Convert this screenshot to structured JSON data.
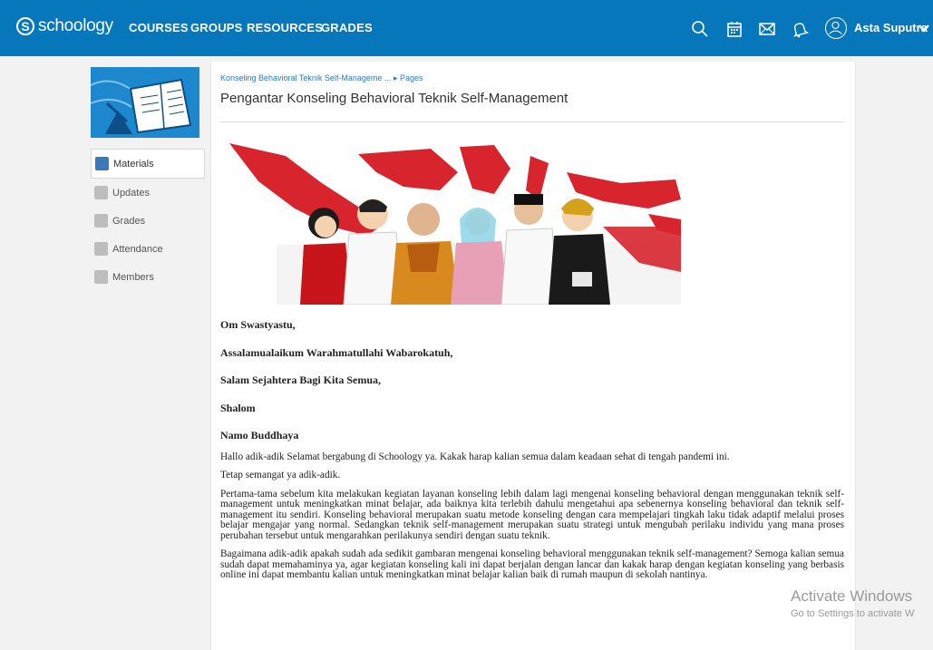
{
  "app": {
    "brand": "schoology",
    "brand_mark": "S",
    "nav": [
      "COURSES",
      "GROUPS",
      "RESOURCES",
      "GRADES"
    ],
    "user_name": "Asta Suputra"
  },
  "sidebar": {
    "items": [
      {
        "label": "Materials",
        "active": true
      },
      {
        "label": "Updates",
        "active": false
      },
      {
        "label": "Grades",
        "active": false
      },
      {
        "label": "Attendance",
        "active": false
      },
      {
        "label": "Members",
        "active": false
      }
    ]
  },
  "page": {
    "breadcrumb_course": "Konseling Behavioral Teknik Self-Manageme ...",
    "breadcrumb_sep": "▸",
    "breadcrumb_section": "Pages",
    "title": "Pengantar Konseling Behavioral Teknik Self-Management"
  },
  "body": {
    "greetings": [
      "Om Swastyastu,",
      "Assalamualaikum Warahmatullahi Wabarokatuh,",
      "Salam Sejahtera Bagi Kita Semua,",
      "Shalom",
      "Namo Buddhaya"
    ],
    "paragraphs": [
      "Hallo adik-adik Selamat bergabung di Schoology ya. Kakak harap kalian semua dalam keadaan sehat di tengah pandemi ini.",
      "Tetap semangat ya adik-adik.",
      "Pertama-tama sebelum kita melakukan kegiatan layanan konseling lebih dalam lagi mengenai konseling behavioral dengan menggunakan teknik self-management untuk meningkatkan minat belajar, ada baiknya kita terlebih dahulu mengetahui apa sebenernya konseling behavioral dan teknik self-management itu sendiri. Konseling behavioral merupakan suatu metode konseling dengan cara mempelajari tingkah laku tidak adaptif melalui proses belajar mengajar yang normal. Sedangkan teknik self-management merupakan suatu strategi untuk mengubah perilaku individu yang mana proses perubahan tersebut untuk mengarahkan perilakunya sendiri dengan suatu teknik.",
      "Bagaimana adik-adik apakah sudah ada sedikit gambaran mengenai konseling behavioral menggunakan teknik self-management? Semoga kalian semua sudah dapat memahaminya ya, agar kegiatan konseling kali ini dapat berjalan dengan lancar dan kakak harap dengan kegiatan konseling yang berbasis online ini dapat membantu kalian untuk meningkatkan minat belajar kalian baik di rumah maupun di sekolah nantinya."
    ]
  },
  "watermark": {
    "line1": "Activate Windows",
    "line2": "Go to Settings to activate W"
  },
  "colors": {
    "header": "#0677ba",
    "link": "#2f79b9",
    "banner_red": "#d8252d"
  }
}
